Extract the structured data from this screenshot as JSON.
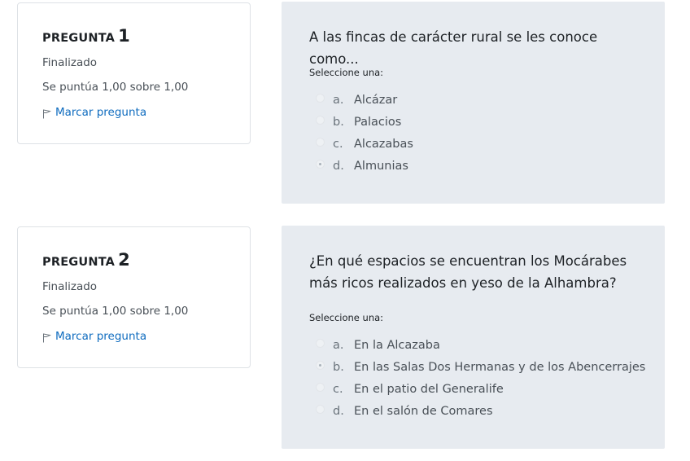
{
  "questions": [
    {
      "label": "PREGUNTA",
      "number": "1",
      "state": "Finalizado",
      "grade": "Se puntúa 1,00 sobre 1,00",
      "flag_label": "Marcar pregunta",
      "text": "A las fincas de carácter rural se les conoce como...",
      "prompt": "Seleccione una:",
      "selected_index": 3,
      "answers": [
        {
          "letter": "a.",
          "text": "Alcázar"
        },
        {
          "letter": "b.",
          "text": "Palacios"
        },
        {
          "letter": "c.",
          "text": "Alcazabas"
        },
        {
          "letter": "d.",
          "text": "Almunias"
        }
      ]
    },
    {
      "label": "PREGUNTA",
      "number": "2",
      "state": "Finalizado",
      "grade": "Se puntúa 1,00 sobre 1,00",
      "flag_label": "Marcar pregunta",
      "text": "¿En qué espacios se encuentran los Mocárabes más ricos realizados en yeso de la Alhambra?",
      "prompt": "Seleccione una:",
      "selected_index": 1,
      "answers": [
        {
          "letter": "a.",
          "text": "En la Alcazaba"
        },
        {
          "letter": "b.",
          "text": "En las Salas Dos Hermanas y de los Abencerrajes"
        },
        {
          "letter": "c.",
          "text": "En el patio del Generalife"
        },
        {
          "letter": "d.",
          "text": "En el salón de Comares"
        }
      ]
    }
  ],
  "icons": {
    "flag": "flag-icon",
    "radio": "radio-icon"
  },
  "colors": {
    "link": "#0f6cbf",
    "content_bg": "#e7ebf0",
    "border": "#dee2e6"
  }
}
